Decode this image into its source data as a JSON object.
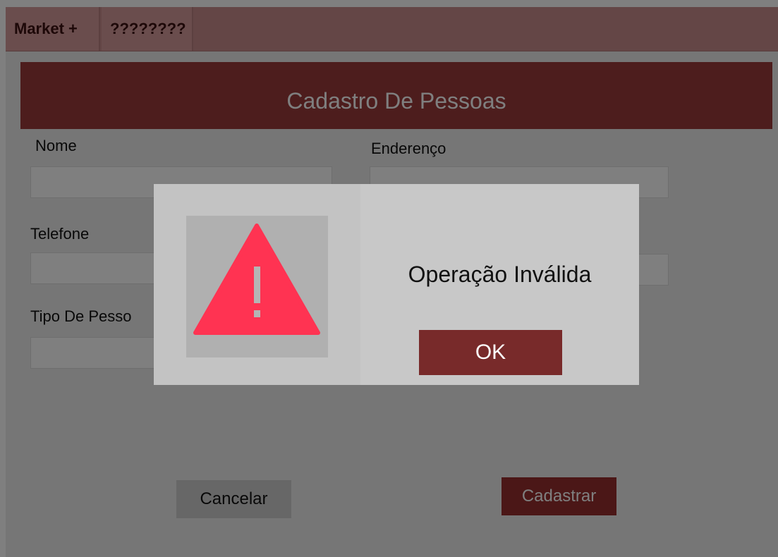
{
  "menu": {
    "items": [
      {
        "label": "Market +"
      },
      {
        "label": "????????"
      }
    ]
  },
  "form": {
    "title": "Cadastro De Pessoas",
    "fields": {
      "nome": {
        "label": "Nome",
        "value": ""
      },
      "endereco": {
        "label": "Enderenço",
        "value": ""
      },
      "telefone": {
        "label": "Telefone",
        "value": ""
      },
      "email": {
        "value": ""
      },
      "tipo_pessoa": {
        "label": "Tipo De Pesso",
        "value": ""
      }
    },
    "cancel_label": "Cancelar",
    "submit_label": "Cadastrar"
  },
  "dialog": {
    "icon": "warning-icon",
    "icon_color": "#ff3352",
    "message": "Operação Inválida",
    "ok_label": "OK",
    "ok_color": "#782a2a"
  },
  "colors": {
    "brand": "#9b3a3a",
    "menu_bar": "#c88c8c"
  }
}
